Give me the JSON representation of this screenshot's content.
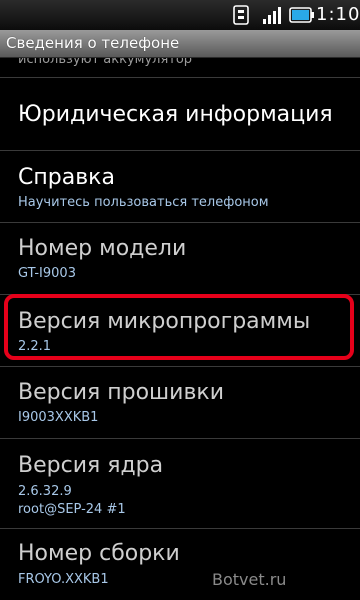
{
  "status_bar": {
    "time": "1:10",
    "icons": [
      "usb-icon",
      "signal-icon",
      "battery-icon"
    ]
  },
  "title_bar": {
    "title": "Сведения о телефоне"
  },
  "items": [
    {
      "title": "",
      "summary": "используют аккумулятор"
    },
    {
      "title": "Юридическая информация",
      "summary": ""
    },
    {
      "title": "Справка",
      "summary": "Научитесь пользоваться телефоном"
    },
    {
      "title": "Номер модели",
      "summary": "GT-I9003"
    },
    {
      "title": "Версия микропрограммы",
      "summary": "2.2.1"
    },
    {
      "title": "Версия прошивки",
      "summary": "I9003XXKB1"
    },
    {
      "title": "Версия ядра",
      "summary": "2.6.32.9",
      "summary2": "root@SEP-24 #1"
    },
    {
      "title": "Номер сборки",
      "summary": "FROYO.XXKB1"
    }
  ],
  "watermark": "Botvet.ru",
  "colors": {
    "summary_blue": "#a8c8e8",
    "highlight_red": "#e6001a"
  }
}
